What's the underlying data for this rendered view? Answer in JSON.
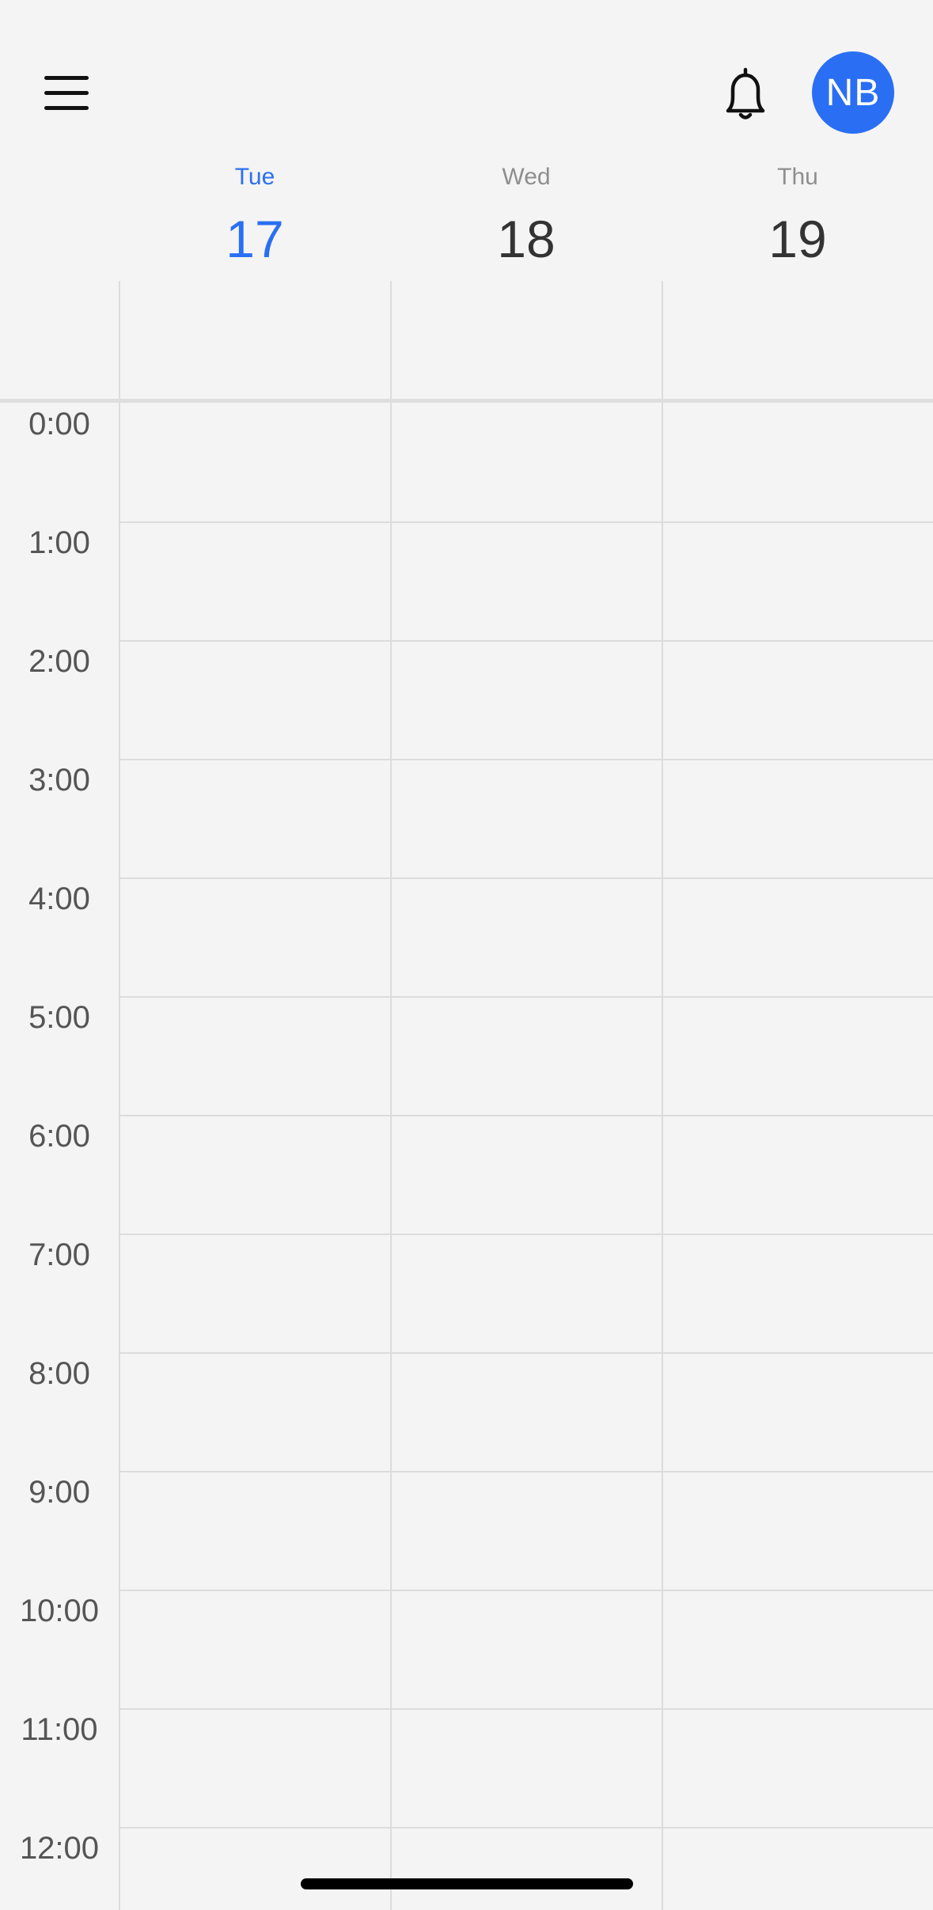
{
  "header": {
    "menu_icon": "hamburger-menu-icon",
    "bell_icon": "bell-icon",
    "avatar_initials": "NB",
    "avatar_color": "#2a6ff3"
  },
  "days": [
    {
      "name": "Tue",
      "number": "17",
      "is_today": true
    },
    {
      "name": "Wed",
      "number": "18",
      "is_today": false
    },
    {
      "name": "Thu",
      "number": "19",
      "is_today": false
    }
  ],
  "hours": [
    "0:00",
    "1:00",
    "2:00",
    "3:00",
    "4:00",
    "5:00",
    "6:00",
    "7:00",
    "8:00",
    "9:00",
    "10:00",
    "11:00",
    "12:00"
  ],
  "colors": {
    "today": "#2a6ff3",
    "day_name": "#8e8e8e",
    "day_number": "#333333",
    "background": "#f4f4f4",
    "grid_line": "#dcdcdc"
  }
}
